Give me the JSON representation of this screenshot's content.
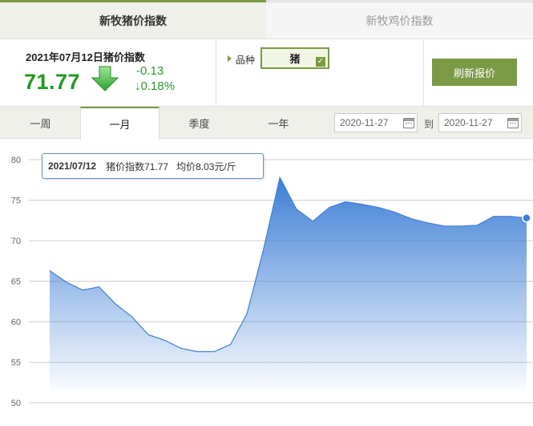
{
  "tabs": {
    "pig": "新牧猪价指数",
    "chicken": "新牧鸡价指数"
  },
  "summary": {
    "date_title": "2021年07月12日猪价指数",
    "price": "71.77",
    "change": "-0.13",
    "change_pct": "↓0.18%",
    "trend_icon": "down-arrow-icon",
    "price_color": "#1e9a1e"
  },
  "variety": {
    "label": "品种",
    "value": "猪"
  },
  "refresh_label": "刷新报价",
  "periods": [
    "一周",
    "一月",
    "季度",
    "一年"
  ],
  "active_period": "一月",
  "date_range": {
    "from": "2020-11-27",
    "separator": "到",
    "to": "2020-11-27"
  },
  "tooltip": {
    "date": "2021/07/12",
    "index_text": "猪价指数71.77",
    "avg_text": "均价8.03元/斤"
  },
  "chart_data": {
    "type": "area",
    "ylim": [
      50,
      80
    ],
    "yticks": [
      50,
      55,
      60,
      65,
      70,
      75,
      80
    ],
    "grid": true,
    "values": [
      66.3,
      64.9,
      63.9,
      64.3,
      62.2,
      60.6,
      58.4,
      57.7,
      56.7,
      56.3,
      56.3,
      57.2,
      61.0,
      68.9,
      77.8,
      73.9,
      72.4,
      74.1,
      74.8,
      74.5,
      74.1,
      73.5,
      72.7,
      72.2,
      71.8,
      71.8,
      71.9,
      73.0,
      73.0,
      72.8
    ],
    "color": "#3d7fd6"
  }
}
